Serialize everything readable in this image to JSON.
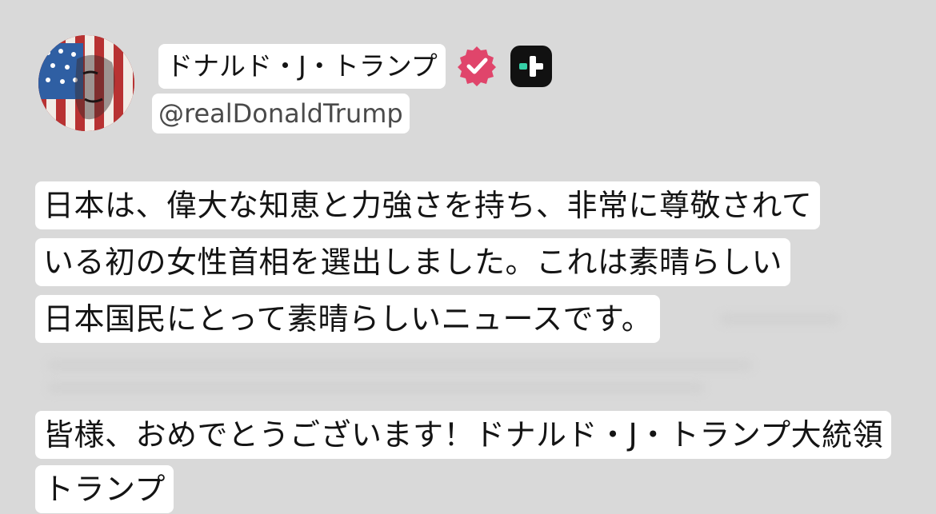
{
  "post": {
    "author": {
      "display_name": "ドナルド・J・トランプ",
      "handle": "@realDonaldTrump",
      "verified_icon": "verified-badge-icon",
      "app_icon": "truth-social-icon",
      "avatar": "avatar"
    },
    "body_lines": [
      "日本は、偉大な知恵と力強さを持ち、非常に尊敬されて",
      "いる初の女性首相を選出しました。これは素晴らしい",
      "日本国民にとって素晴らしいニュースです。"
    ],
    "signoff_lines": [
      "皆様、おめでとうございます！ドナルド・J・トランプ大統領",
      "トランプ"
    ],
    "colors": {
      "background": "#d9d9d9",
      "chip_background": "#ffffff",
      "verified_badge": "#e0456b",
      "app_icon_bg": "#111111",
      "app_icon_accent": "#35d0a8"
    }
  }
}
